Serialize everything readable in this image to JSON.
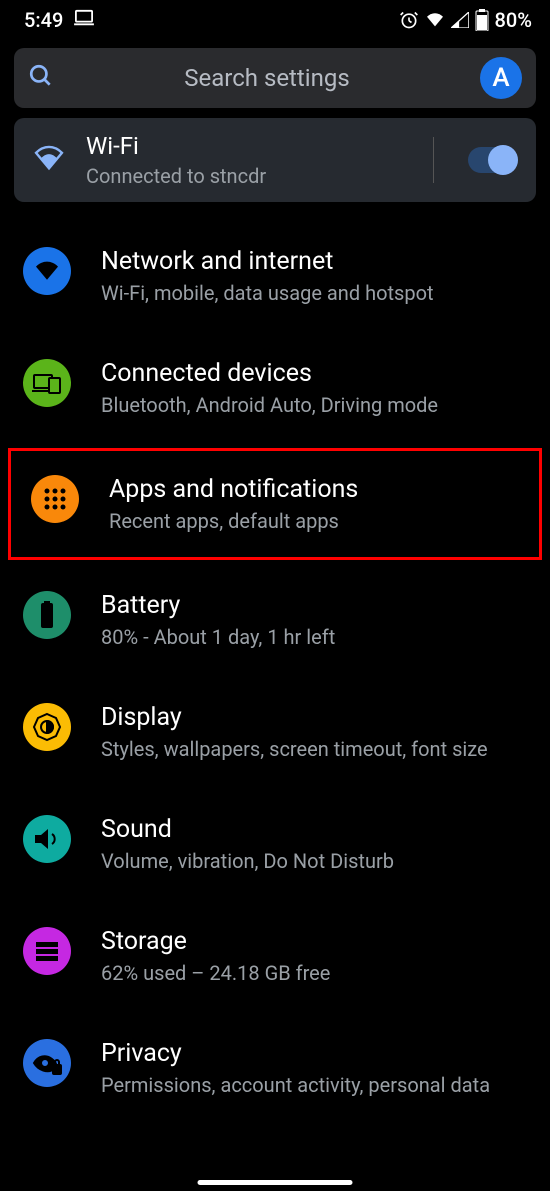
{
  "status": {
    "time": "5:49",
    "battery": "80%"
  },
  "search": {
    "placeholder": "Search settings",
    "avatar_initial": "A"
  },
  "wifi_card": {
    "title": "Wi-Fi",
    "subtitle": "Connected to stncdr",
    "toggle_on": true
  },
  "items": [
    {
      "title": "Network and internet",
      "subtitle": "Wi-Fi, mobile, data usage and hotspot",
      "icon": "wifi",
      "bg": "#1a73e8"
    },
    {
      "title": "Connected devices",
      "subtitle": "Bluetooth, Android Auto, Driving mode",
      "icon": "devices",
      "bg": "#5bb41a"
    },
    {
      "title": "Apps and notifications",
      "subtitle": "Recent apps, default apps",
      "icon": "apps",
      "bg": "#f9880a",
      "highlighted": true
    },
    {
      "title": "Battery",
      "subtitle": "80% - About 1 day, 1 hr left",
      "icon": "battery",
      "bg": "#1e8e6a"
    },
    {
      "title": "Display",
      "subtitle": "Styles, wallpapers, screen timeout, font size",
      "icon": "brightness",
      "bg": "#fbbc04"
    },
    {
      "title": "Sound",
      "subtitle": "Volume, vibration, Do Not Disturb",
      "icon": "sound",
      "bg": "#0eaba0"
    },
    {
      "title": "Storage",
      "subtitle": "62% used – 24.18 GB free",
      "icon": "storage",
      "bg": "#c528e2"
    },
    {
      "title": "Privacy",
      "subtitle": "Permissions, account activity, personal data",
      "icon": "privacy",
      "bg": "#2a6fe0"
    }
  ]
}
